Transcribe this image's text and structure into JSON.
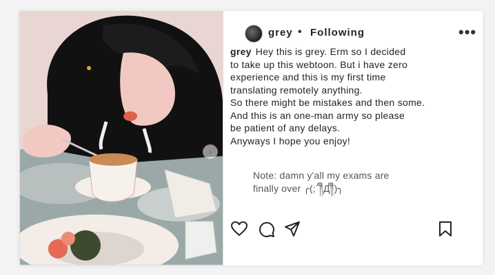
{
  "post": {
    "username": "grey",
    "separator": "•",
    "follow_status": "Following",
    "more_label": "•••",
    "carousel_next": "›"
  },
  "caption": {
    "username": "grey",
    "lines": [
      "Hey this is grey. Erm so I decided",
      "to take up this webtoon. But i have zero",
      "experience and this is my first time",
      "translating remotely anything.",
      "So there might be mistakes and then some.",
      "And this is an one-man army so please",
      "be patient of any delays.",
      "Anyways I hope you enjoy!"
    ]
  },
  "note": {
    "lines": [
      "Note: damn y'all my exams are",
      "finally over ╭(;´༎ຶД༎ຶ)╮"
    ]
  },
  "actions": {
    "icons": [
      "heart-icon",
      "comment-icon",
      "share-icon",
      "bookmark-icon"
    ]
  }
}
